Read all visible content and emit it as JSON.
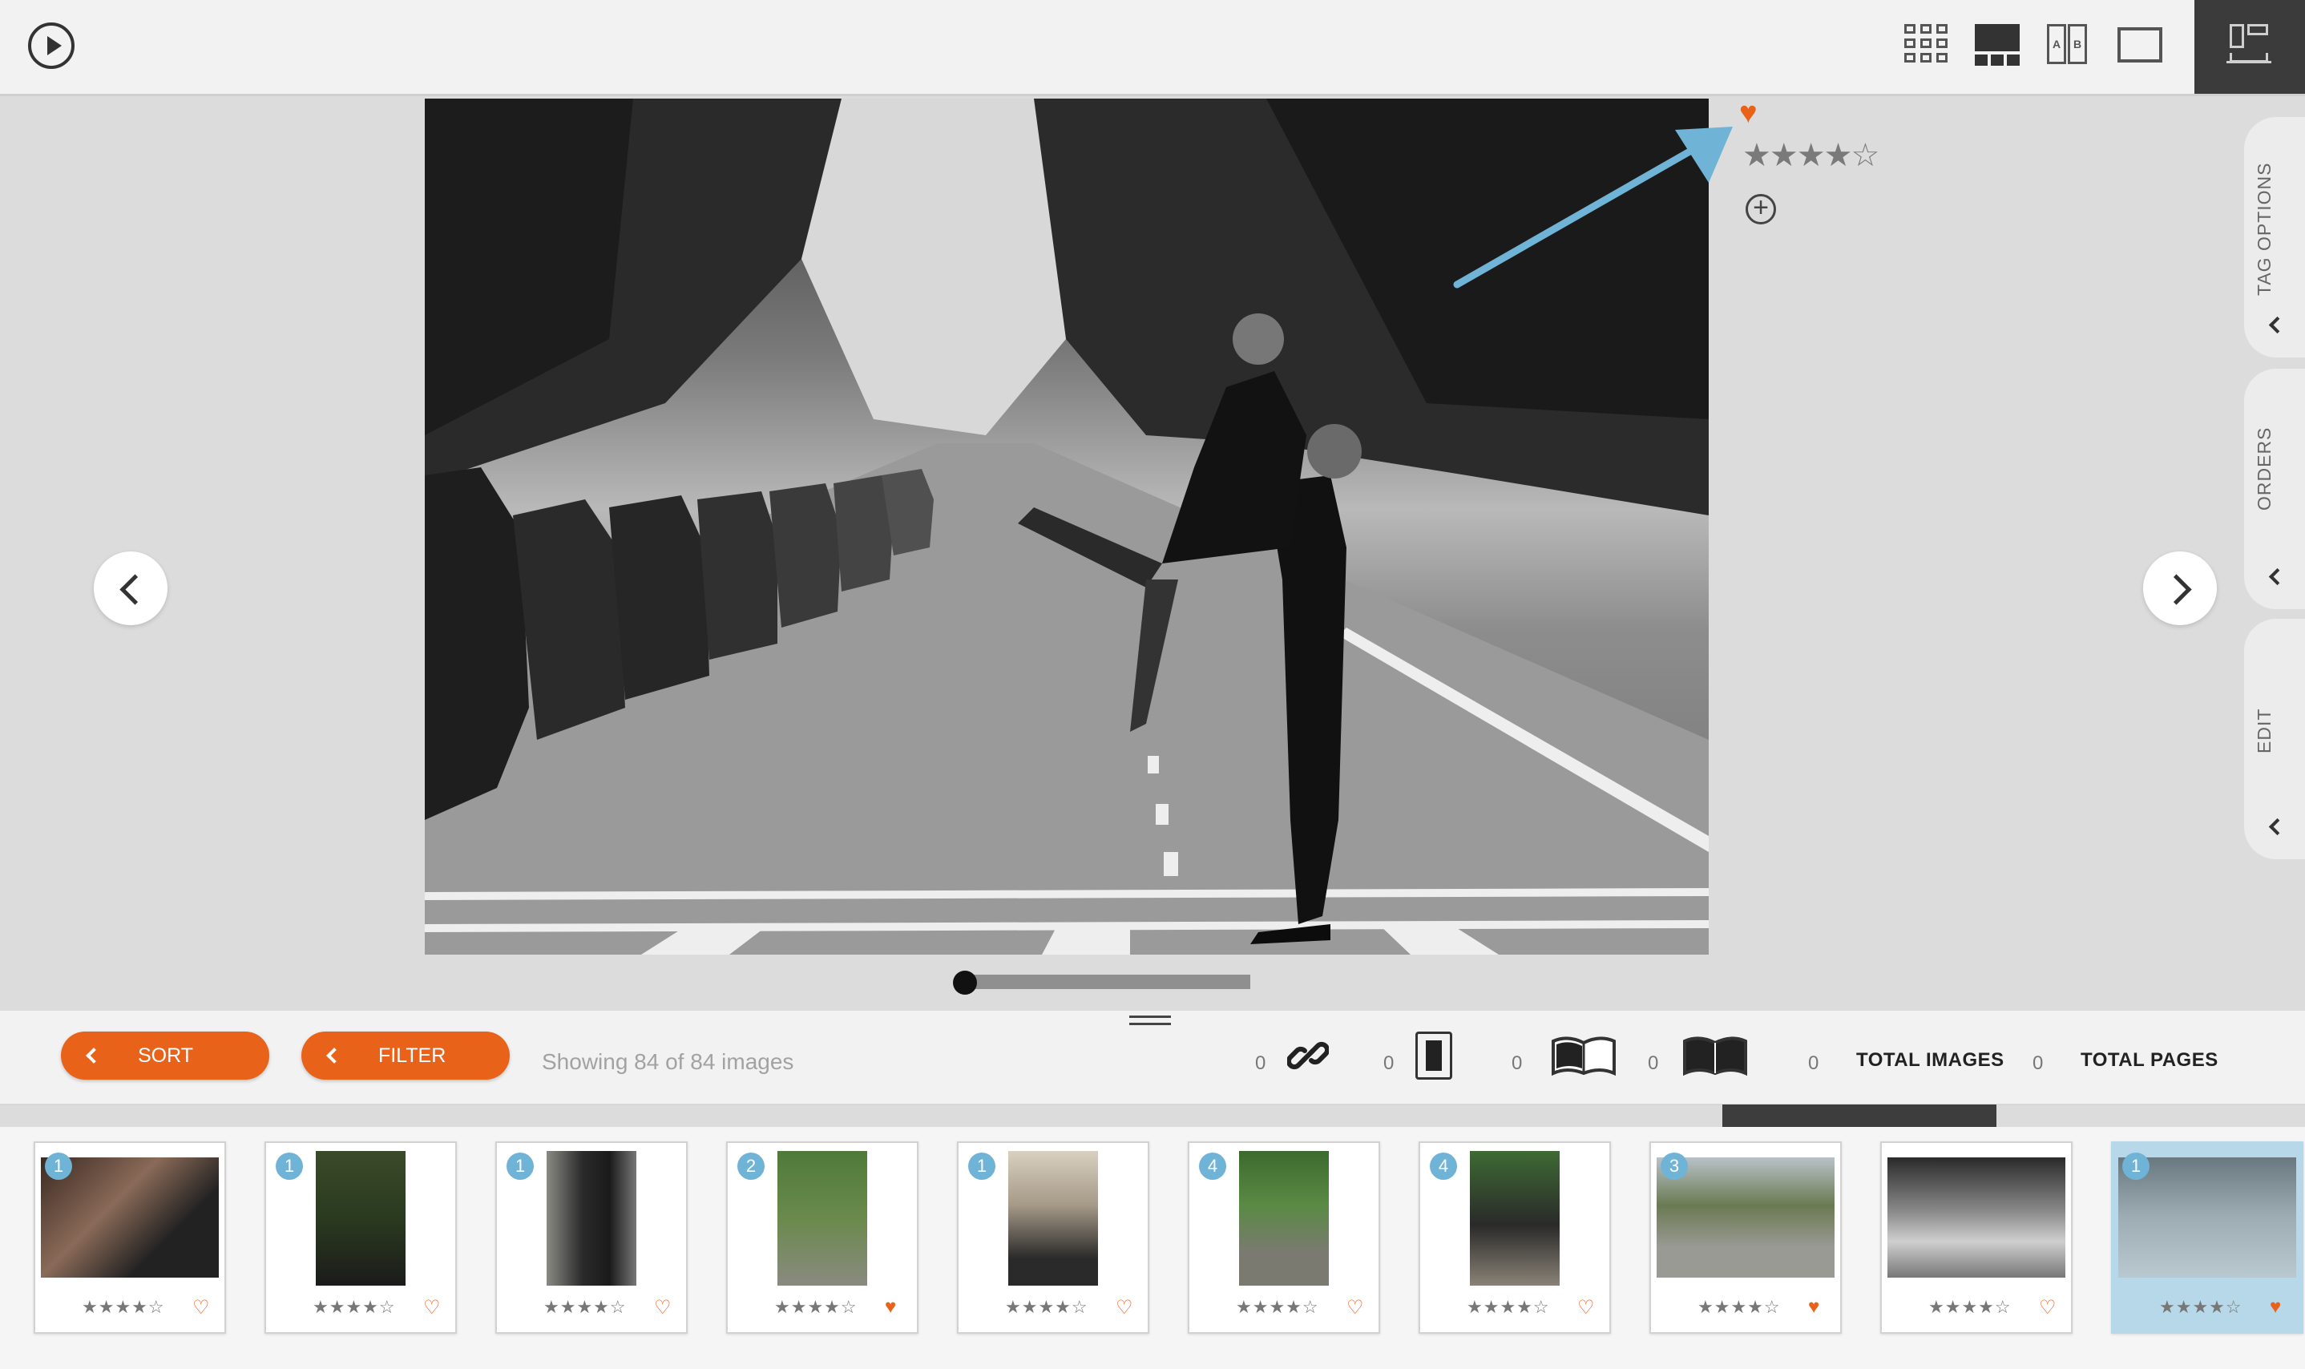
{
  "viewer": {
    "rating_display": "★★★★☆",
    "favorite_icon": "♥",
    "add_icon": "+",
    "heart_color": "#e8621a",
    "scrub_position": 0.0
  },
  "side_tabs": {
    "tag_options": "TAG OPTIONS",
    "orders": "ORDERS",
    "edit": "EDIT"
  },
  "toolbar": {
    "sort_label": "SORT",
    "filter_label": "FILTER",
    "showing_text": "Showing 84 of 84 images",
    "link_count": "0",
    "single_page_count": "0",
    "open_book_count": "0",
    "closed_book_count": "0",
    "total_images_count": "0",
    "total_images_label": "TOTAL IMAGES",
    "total_pages_count": "0",
    "total_pages_label": "TOTAL PAGES"
  },
  "filmstrip": [
    {
      "badge": "1",
      "stars": "★★★★☆",
      "heart": "♡"
    },
    {
      "badge": "1",
      "stars": "★★★★☆",
      "heart": "♡"
    },
    {
      "badge": "1",
      "stars": "★★★★☆",
      "heart": "♡"
    },
    {
      "badge": "2",
      "stars": "★★★★☆",
      "heart": "♥"
    },
    {
      "badge": "1",
      "stars": "★★★★☆",
      "heart": "♡"
    },
    {
      "badge": "4",
      "stars": "★★★★☆",
      "heart": "♡"
    },
    {
      "badge": "4",
      "stars": "★★★★☆",
      "heart": "♡"
    },
    {
      "badge": "3",
      "stars": "★★★★☆",
      "heart": "♥"
    },
    {
      "badge": "",
      "stars": "★★★★☆",
      "heart": "♡"
    },
    {
      "badge": "1",
      "stars": "★★★★☆",
      "heart": "♥"
    }
  ],
  "colors": {
    "accent": "#e8621a",
    "badge": "#6fb3d6",
    "annotation_arrow": "#6fb3d6",
    "selected_card": "#b6d8e8"
  }
}
